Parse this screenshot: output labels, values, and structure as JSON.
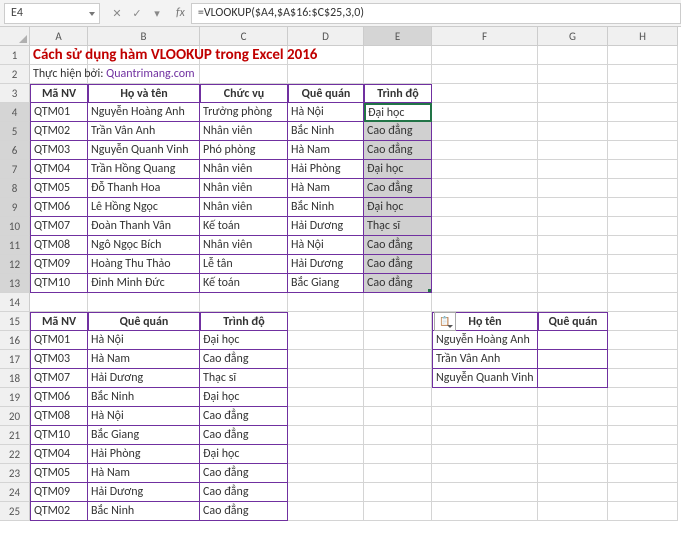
{
  "nameBox": "E4",
  "formula": "=VLOOKUP($A4,$A$16:$C$25,3,0)",
  "cols": [
    "A",
    "B",
    "C",
    "D",
    "E",
    "F",
    "G",
    "H"
  ],
  "title": "Cách sử dụng hàm VLOOKUP trong Excel 2016",
  "subPrefix": "Thực hiện bởi: ",
  "subLink": "Quantrimang.com",
  "hdr1": {
    "a": "Mã NV",
    "b": "Họ và tên",
    "c": "Chức vụ",
    "d": "Quê quán",
    "e": "Trình độ"
  },
  "t1": [
    {
      "a": "QTM01",
      "b": "Nguyễn Hoàng Anh",
      "c": "Trưởng phòng",
      "d": "Hà Nội",
      "e": "Đại học"
    },
    {
      "a": "QTM02",
      "b": "Trần Vân Anh",
      "c": "Nhân viên",
      "d": "Bắc Ninh",
      "e": "Cao đẳng"
    },
    {
      "a": "QTM03",
      "b": "Nguyễn Quanh Vinh",
      "c": "Phó phòng",
      "d": "Hà Nam",
      "e": "Cao đẳng"
    },
    {
      "a": "QTM04",
      "b": "Trần Hồng Quang",
      "c": "Nhân viên",
      "d": "Hải Phòng",
      "e": "Đại học"
    },
    {
      "a": "QTM05",
      "b": "Đỗ Thanh Hoa",
      "c": "Nhân viên",
      "d": "Hà Nam",
      "e": "Cao đẳng"
    },
    {
      "a": "QTM06",
      "b": "Lê Hồng Ngọc",
      "c": "Nhân viên",
      "d": "Bắc Ninh",
      "e": "Đại học"
    },
    {
      "a": "QTM07",
      "b": "Đoàn Thanh Vân",
      "c": "Kế toán",
      "d": "Hải Dương",
      "e": "Thạc sĩ"
    },
    {
      "a": "QTM08",
      "b": "Ngô Ngọc Bích",
      "c": "Nhân viên",
      "d": "Hà Nội",
      "e": "Cao đẳng"
    },
    {
      "a": "QTM09",
      "b": "Hoàng Thu Thảo",
      "c": "Lễ tân",
      "d": "Hải Dương",
      "e": "Cao đẳng"
    },
    {
      "a": "QTM10",
      "b": "Đinh Minh Đức",
      "c": "Kế toán",
      "d": "Bắc Giang",
      "e": "Cao đẳng"
    }
  ],
  "hdr2": {
    "a": "Mã NV",
    "b": "Quê quán",
    "c": "Trình độ"
  },
  "t2": [
    {
      "a": "QTM01",
      "b": "Hà Nội",
      "c": "Đại học"
    },
    {
      "a": "QTM03",
      "b": "Hà Nam",
      "c": "Cao đẳng"
    },
    {
      "a": "QTM07",
      "b": "Hải Dương",
      "c": "Thạc sĩ"
    },
    {
      "a": "QTM06",
      "b": "Bắc Ninh",
      "c": "Đại học"
    },
    {
      "a": "QTM08",
      "b": "Hà Nội",
      "c": "Cao đẳng"
    },
    {
      "a": "QTM10",
      "b": "Bắc Giang",
      "c": "Cao đẳng"
    },
    {
      "a": "QTM04",
      "b": "Hải Phòng",
      "c": "Đại học"
    },
    {
      "a": "QTM05",
      "b": "Hà Nam",
      "c": "Cao đẳng"
    },
    {
      "a": "QTM09",
      "b": "Hải Dương",
      "c": "Cao đẳng"
    },
    {
      "a": "QTM02",
      "b": "Bắc Ninh",
      "c": "Cao đẳng"
    }
  ],
  "hdr3": {
    "f": "Họ tên",
    "g": "Quê quán"
  },
  "t3": [
    {
      "f": "Nguyễn Hoàng Anh",
      "g": ""
    },
    {
      "f": "Trần Vân Anh",
      "g": ""
    },
    {
      "f": "Nguyễn Quanh Vinh",
      "g": ""
    }
  ],
  "icons": {
    "cancel": "✕",
    "confirm": "✓",
    "fx": "fx",
    "dd": "▾",
    "paste": "📋"
  }
}
